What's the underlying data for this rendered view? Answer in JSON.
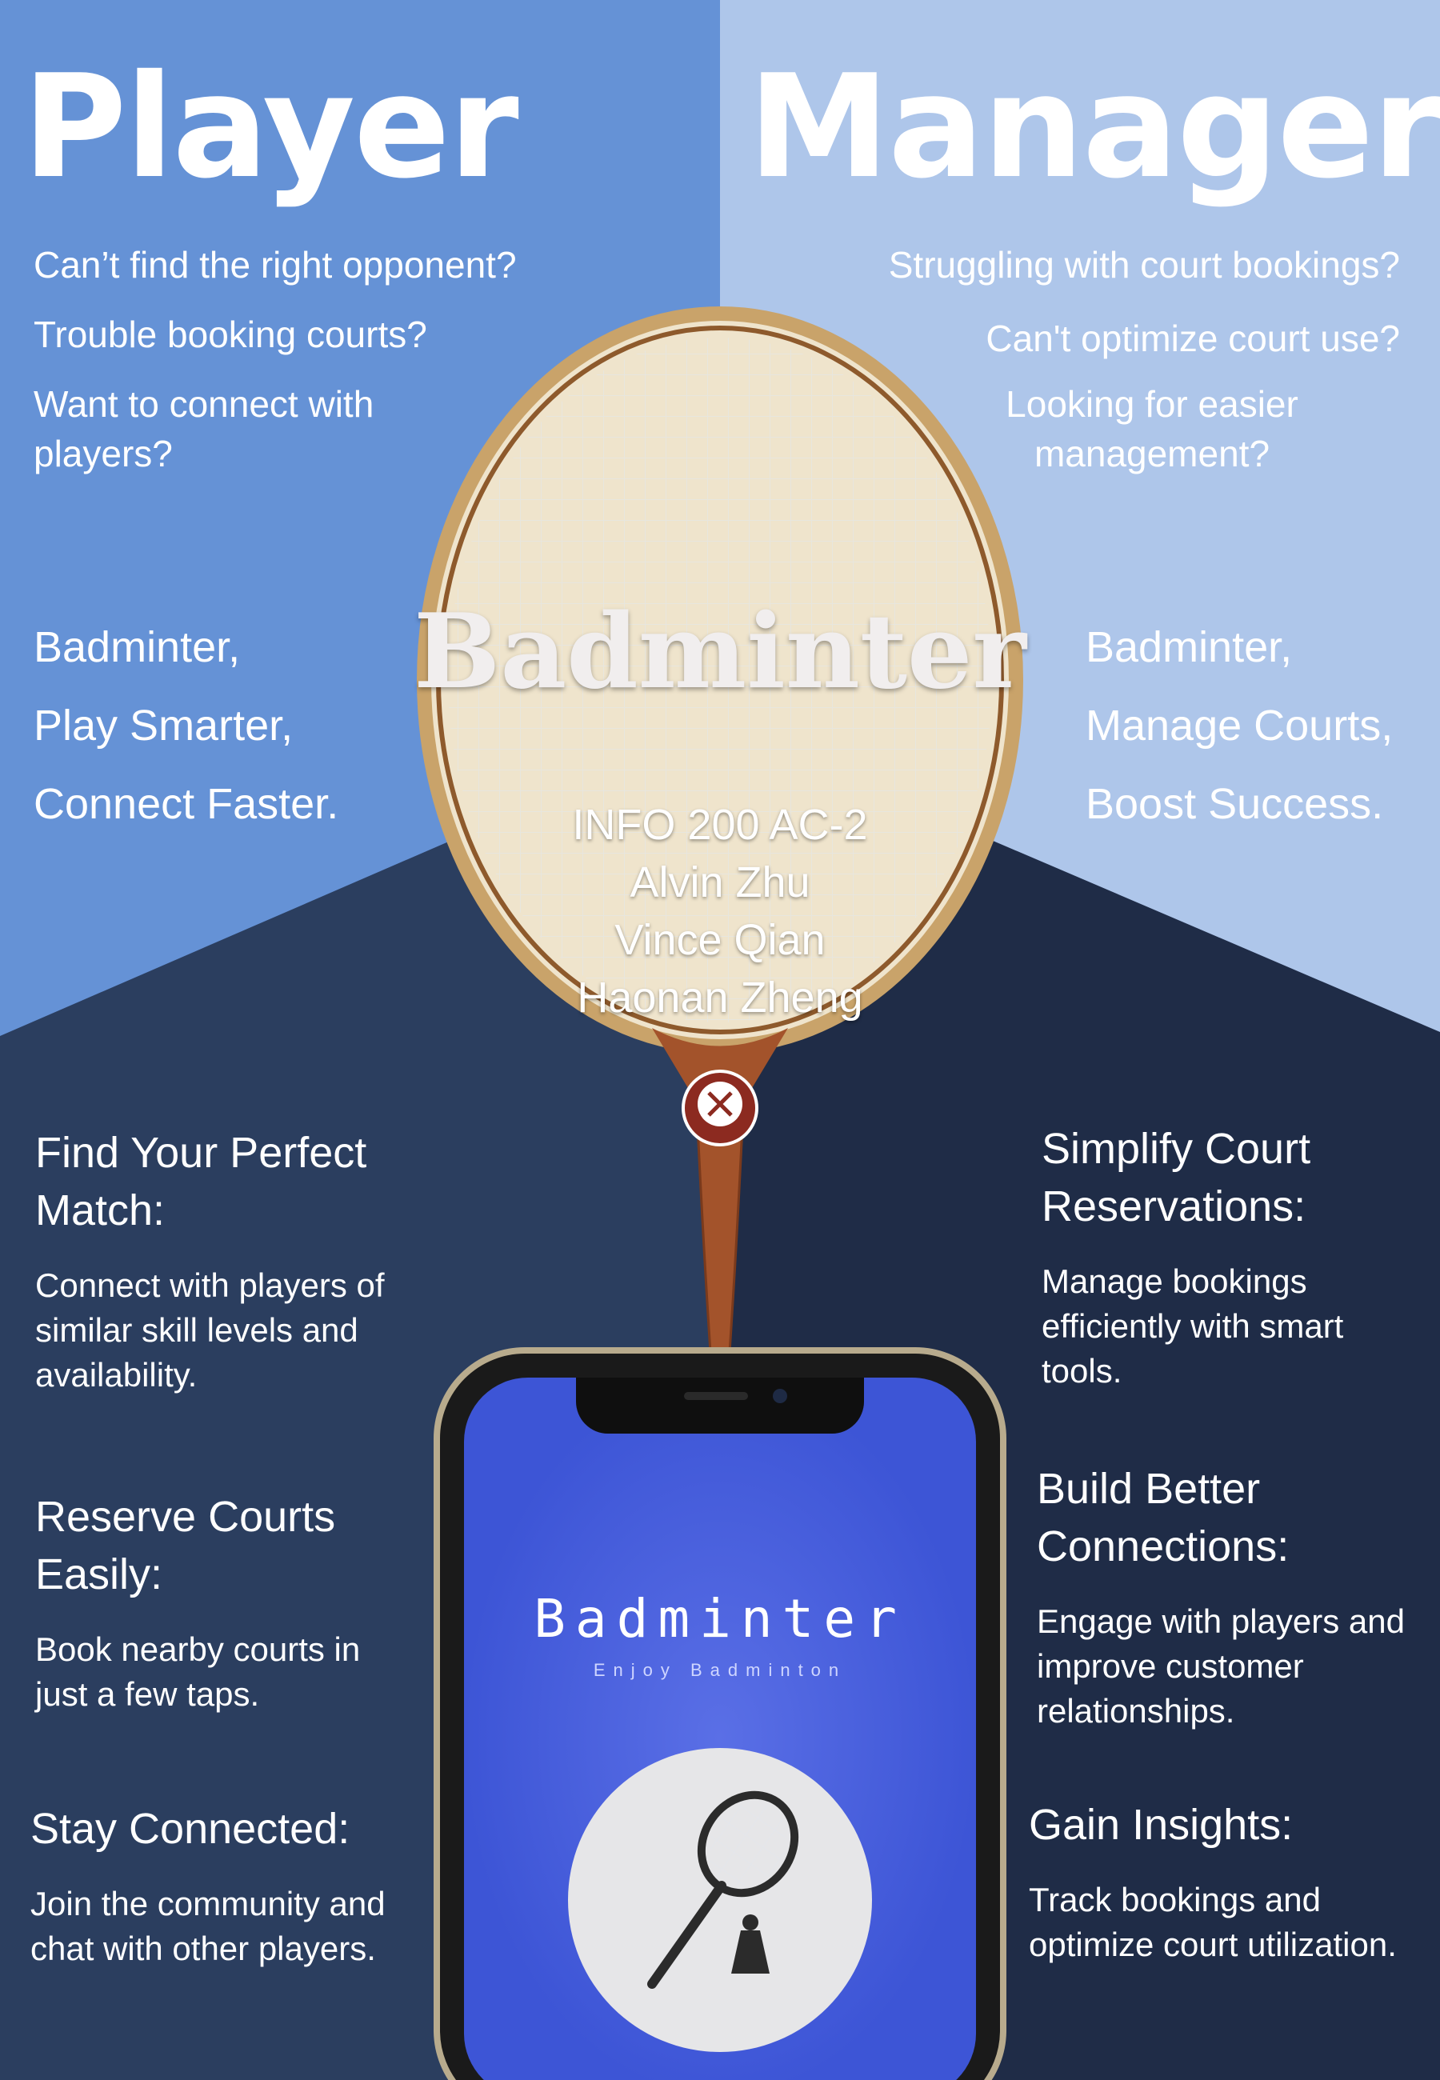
{
  "player": {
    "title": "Player",
    "questions": [
      "Can’t find the right opponent?",
      "Trouble booking courts?",
      "Want to connect with players?"
    ],
    "taglines": [
      "Badminter,",
      "Play Smarter,",
      "Connect Faster."
    ],
    "features": [
      {
        "title": "Find Your Perfect Match:",
        "desc": "Connect with players of similar skill levels and availability."
      },
      {
        "title": "Reserve Courts Easily:",
        "desc": "Book nearby courts in just a few taps."
      },
      {
        "title": "Stay Connected:",
        "desc": "Join the community and chat with other players."
      }
    ]
  },
  "manager": {
    "title": "Manager",
    "questions": [
      "Struggling with court bookings?",
      "Can't optimize court use?",
      "Looking for easier management?"
    ],
    "taglines": [
      "Badminter,",
      "Manage Courts,",
      "Boost Success."
    ],
    "features": [
      {
        "title": "Simplify Court Reservations:",
        "desc": "Manage bookings efficiently with smart tools."
      },
      {
        "title": "Build Better Connections:",
        "desc": "Engage with players and improve customer relationships."
      },
      {
        "title": "Gain Insights:",
        "desc": "Track bookings and optimize court utilization."
      }
    ]
  },
  "center": {
    "brand": "Badminter",
    "info": [
      "INFO 200 AC-2",
      "Alvin Zhu",
      "Vince Qian",
      "Haonan Zheng"
    ]
  },
  "phone": {
    "brand": "Badminter",
    "tagline": "Enjoy Badminton",
    "icon": "badminton-racket-shuttlecock-icon"
  },
  "colors": {
    "player_bg": "#6592d6",
    "manager_bg": "#aec6ea",
    "bottom_left": "#2b3e5f",
    "bottom_right": "#1f2c47",
    "phone_screen": "#3d55d6"
  }
}
